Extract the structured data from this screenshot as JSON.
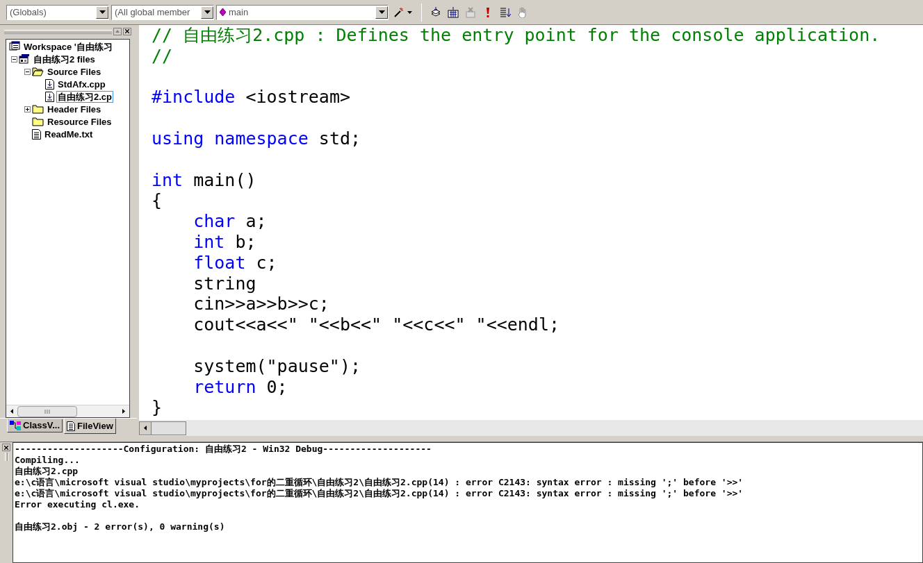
{
  "toolbar": {
    "combos": [
      {
        "value": "(Globals)"
      },
      {
        "value": "(All global member"
      },
      {
        "value": "main"
      }
    ]
  },
  "workspace": {
    "tree": [
      {
        "label": "Workspace '自由练习",
        "kind": "workspace",
        "selected": false,
        "children": [
          {
            "label": "自由练习2 files",
            "kind": "project",
            "expanded": true,
            "selected": false,
            "children": [
              {
                "label": "Source Files",
                "kind": "folder",
                "expanded": true,
                "selected": false,
                "children": [
                  {
                    "label": "StdAfx.cpp",
                    "kind": "source",
                    "selected": false
                  },
                  {
                    "label": "自由练习2.cp",
                    "kind": "source",
                    "selected": true
                  }
                ]
              },
              {
                "label": "Header Files",
                "kind": "folder",
                "expanded": false,
                "selected": false
              },
              {
                "label": "Resource Files",
                "kind": "folder",
                "selected": false
              },
              {
                "label": "ReadMe.txt",
                "kind": "text",
                "selected": false
              }
            ]
          }
        ]
      }
    ],
    "tabs": [
      {
        "label": "ClassV...",
        "kind": "class",
        "selected": false
      },
      {
        "label": "FileView",
        "kind": "file",
        "selected": true
      }
    ]
  },
  "editor": {
    "blocks": [
      [
        [
          {
            "kind": "comment",
            "text": "// 自由练习2.cpp : Defines the entry point for the console application."
          }
        ],
        [
          {
            "kind": "comment",
            "text": "//"
          }
        ]
      ],
      [
        [
          {
            "kind": "keyword",
            "text": "#include"
          },
          {
            "kind": "plain",
            "text": " <iostream>"
          }
        ]
      ],
      [
        [
          {
            "kind": "keyword",
            "text": "using namespace"
          },
          {
            "kind": "plain",
            "text": " std;"
          }
        ]
      ],
      [
        [
          {
            "kind": "keyword",
            "text": "int"
          },
          {
            "kind": "plain",
            "text": " main()"
          }
        ],
        [
          {
            "kind": "plain",
            "text": "{"
          }
        ],
        [
          {
            "kind": "keyword",
            "text": "    char"
          },
          {
            "kind": "plain",
            "text": " a;"
          }
        ],
        [
          {
            "kind": "keyword",
            "text": "    int"
          },
          {
            "kind": "plain",
            "text": " b;"
          }
        ],
        [
          {
            "kind": "keyword",
            "text": "    float"
          },
          {
            "kind": "plain",
            "text": " c;"
          }
        ],
        [
          {
            "kind": "plain",
            "text": "    string"
          }
        ],
        [
          {
            "kind": "plain",
            "text": "    cin>>a>>b>>c;"
          }
        ],
        [
          {
            "kind": "plain",
            "text": "    cout<<a<<\" \"<<b<<\" \"<<c<<\" \"<<endl;"
          }
        ]
      ],
      [
        [
          {
            "kind": "plain",
            "text": "    system(\"pause\");"
          }
        ],
        [
          {
            "kind": "keyword",
            "text": "    return"
          },
          {
            "kind": "plain",
            "text": " 0;"
          }
        ],
        [
          {
            "kind": "plain",
            "text": "}"
          }
        ]
      ]
    ]
  },
  "output": {
    "groups": [
      [
        "--------------------Configuration: 自由练习2 - Win32 Debug--------------------",
        "Compiling...",
        "自由练习2.cpp",
        "e:\\c语言\\microsoft visual studio\\myprojects\\for的二重循环\\自由练习2\\自由练习2.cpp(14) : error C2143: syntax error : missing ';' before '>>'",
        "e:\\c语言\\microsoft visual studio\\myprojects\\for的二重循环\\自由练习2\\自由练习2.cpp(14) : error C2143: syntax error : missing ';' before '>>'",
        "Error executing cl.exe."
      ],
      [
        "自由练习2.obj - 2 error(s), 0 warning(s)"
      ]
    ]
  }
}
